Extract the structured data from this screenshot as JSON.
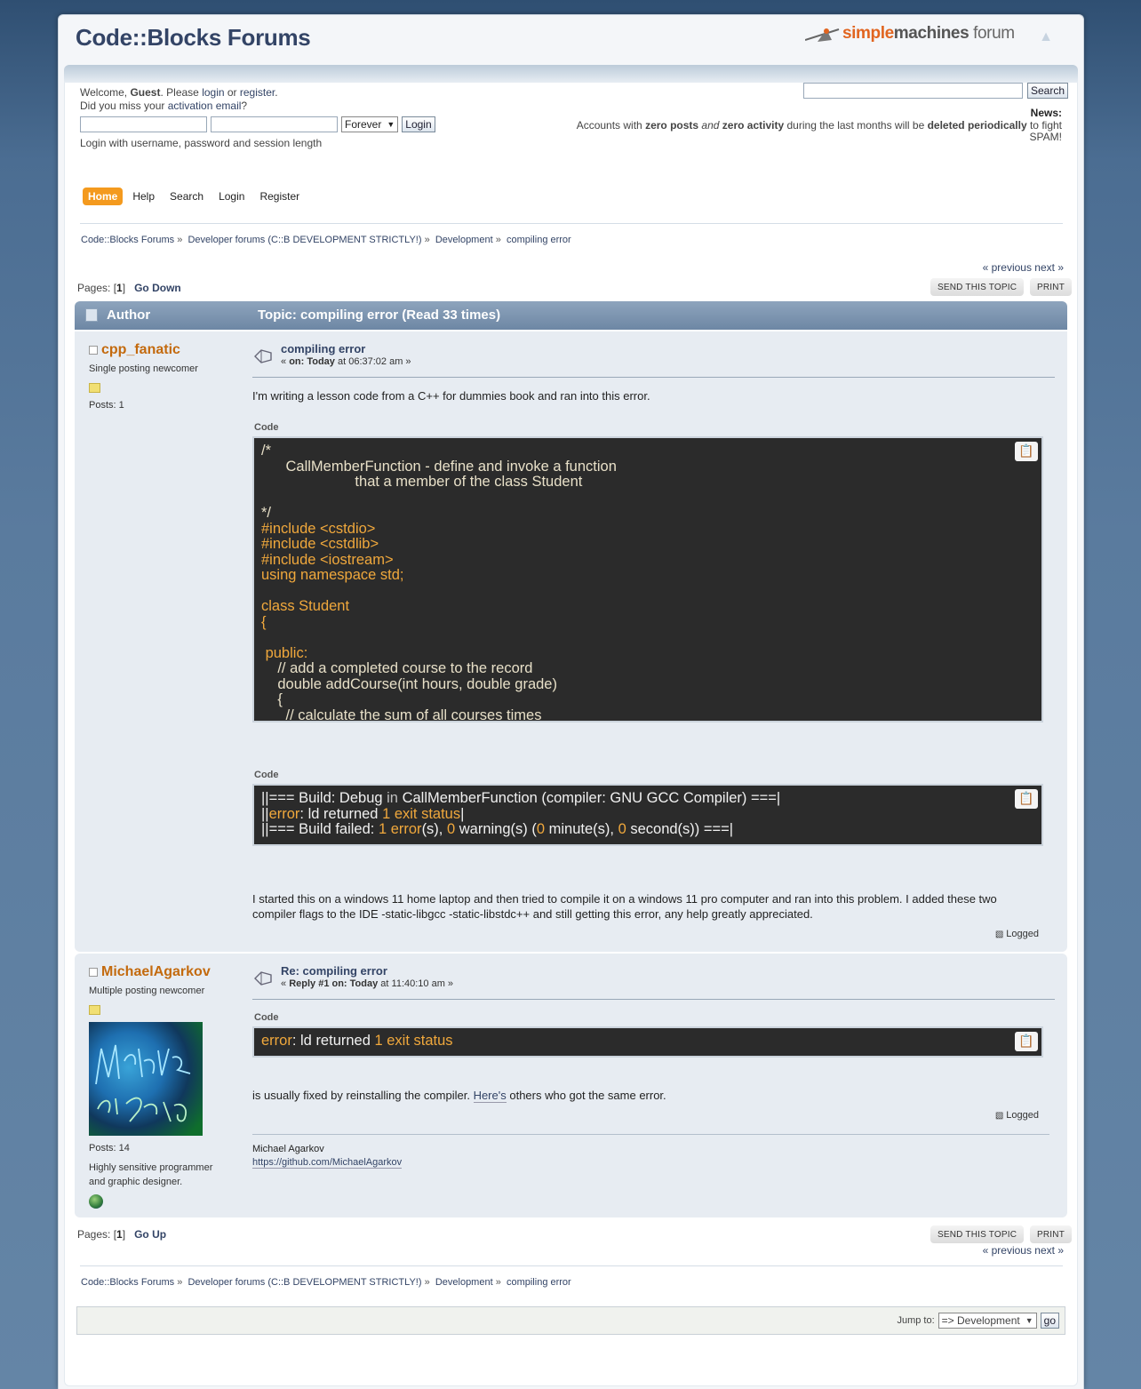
{
  "forum_title": "Code::Blocks Forums",
  "logo": {
    "part1": "simple",
    "part2": "machines",
    "part3": " forum"
  },
  "user_area": {
    "welcome_prefix": "Welcome, ",
    "guest": "Guest",
    "please": ". Please ",
    "login": "login",
    "or": " or ",
    "register": "register",
    "period": ".",
    "miss_prefix": "Did you miss your ",
    "activation": "activation email",
    "miss_suffix": "?",
    "session_option": "Forever",
    "login_button": "Login",
    "login_hint": "Login with username, password and session length"
  },
  "search": {
    "button": "Search",
    "placeholder": ""
  },
  "news": {
    "label": "News:",
    "t1": "Accounts with ",
    "b1": "zero posts",
    "i1": "and",
    "b2": "zero activity",
    "t2": " during the last months will be ",
    "b3": "deleted periodically",
    "t3": " to fight SPAM!"
  },
  "menu": [
    "Home",
    "Help",
    "Search",
    "Login",
    "Register"
  ],
  "breadcrumb": [
    "Code::Blocks Forums",
    "Developer forums (C::B DEVELOPMENT STRICTLY!)",
    "Development",
    "compiling error"
  ],
  "breadcrumb_sep": " »",
  "pages": {
    "label": "Pages: [",
    "num": "1",
    "close": "]",
    "go_down": "Go Down",
    "go_up": "Go Up"
  },
  "prevnext": "« previous next »",
  "buttons": {
    "send_topic": "SEND THIS TOPIC",
    "print": "PRINT"
  },
  "header": {
    "author": "Author",
    "topic": "Topic: compiling error  (Read 33 times)"
  },
  "posts": [
    {
      "author": "cpp_fanatic",
      "group": "Single posting newcomer",
      "posts": "Posts: 1",
      "subject": "compiling error",
      "date_prefix": "« ",
      "date_on": "on: Today",
      "date_time": " at 06:37:02 am »",
      "intro": "I'm writing a lesson code from a C++ for dummies book and ran into this error.",
      "code_label": "Code",
      "code_lines": [
        "/*",
        "      CallMemberFunction - define and invoke a function",
        "                       that a member of the class Student",
        "",
        "*/",
        "#include <cstdio>",
        "#include <cstdlib>",
        "#include <iostream>",
        "using namespace std;",
        "",
        "class Student",
        "{",
        "",
        " public:",
        "    // add a completed course to the record",
        "    double addCourse(int hours, double grade)",
        "    {",
        "      // calculate the sum of all courses times"
      ],
      "build_label": "Code",
      "build": {
        "l1a": "||=== Build: Debug ",
        "l1b": "in",
        "l1c": " CallMemberFunction (compiler: GNU GCC Compiler) ===|",
        "l2a": "||",
        "l2b": "error",
        "l2c": ": ld returned ",
        "l2d": "1 exit status",
        "l2e": "|",
        "l3a": "||=== Build failed: ",
        "l3b": "1 error",
        "l3c": "(s), ",
        "l3d": "0",
        "l3e": " warning(s) (",
        "l3f": "0",
        "l3g": " minute(s), ",
        "l3h": "0",
        "l3i": " second(s)) ===|"
      },
      "outro": "I started this on a windows 11 home laptop and then tried to compile it on a windows 11 pro computer and ran into this problem. I added these two compiler flags to the IDE -static-libgcc -static-libstdc++ and still getting this error, any help greatly appreciated.",
      "logged": "Logged"
    },
    {
      "author": "MichaelAgarkov",
      "group": "Multiple posting newcomer",
      "posts": "Posts: 14",
      "text": "Highly sensitive programmer and graphic designer.",
      "subject": "Re: compiling error",
      "date_prefix": "« ",
      "date_on": "Reply #1 on: Today",
      "date_time": " at 11:40:10 am »",
      "code_label": "Code",
      "code": {
        "a": "error",
        "b": ": ld returned ",
        "c": "1 exit status"
      },
      "body_a": "is usually fixed by reinstalling the compiler. ",
      "body_link": "Here's",
      "body_b": " others who got the same error.",
      "logged": "Logged",
      "sig_name": "Michael Agarkov",
      "sig_link": "https://github.com/MichaelAgarkov"
    }
  ],
  "jump": {
    "label": "Jump to:",
    "selected": "=> Development",
    "go": "go"
  },
  "colors": {
    "accent": "#f49a1e",
    "author_name": "#c36a0e",
    "code_bg": "#2b2b2b",
    "header_bar": "#7c94b0"
  }
}
